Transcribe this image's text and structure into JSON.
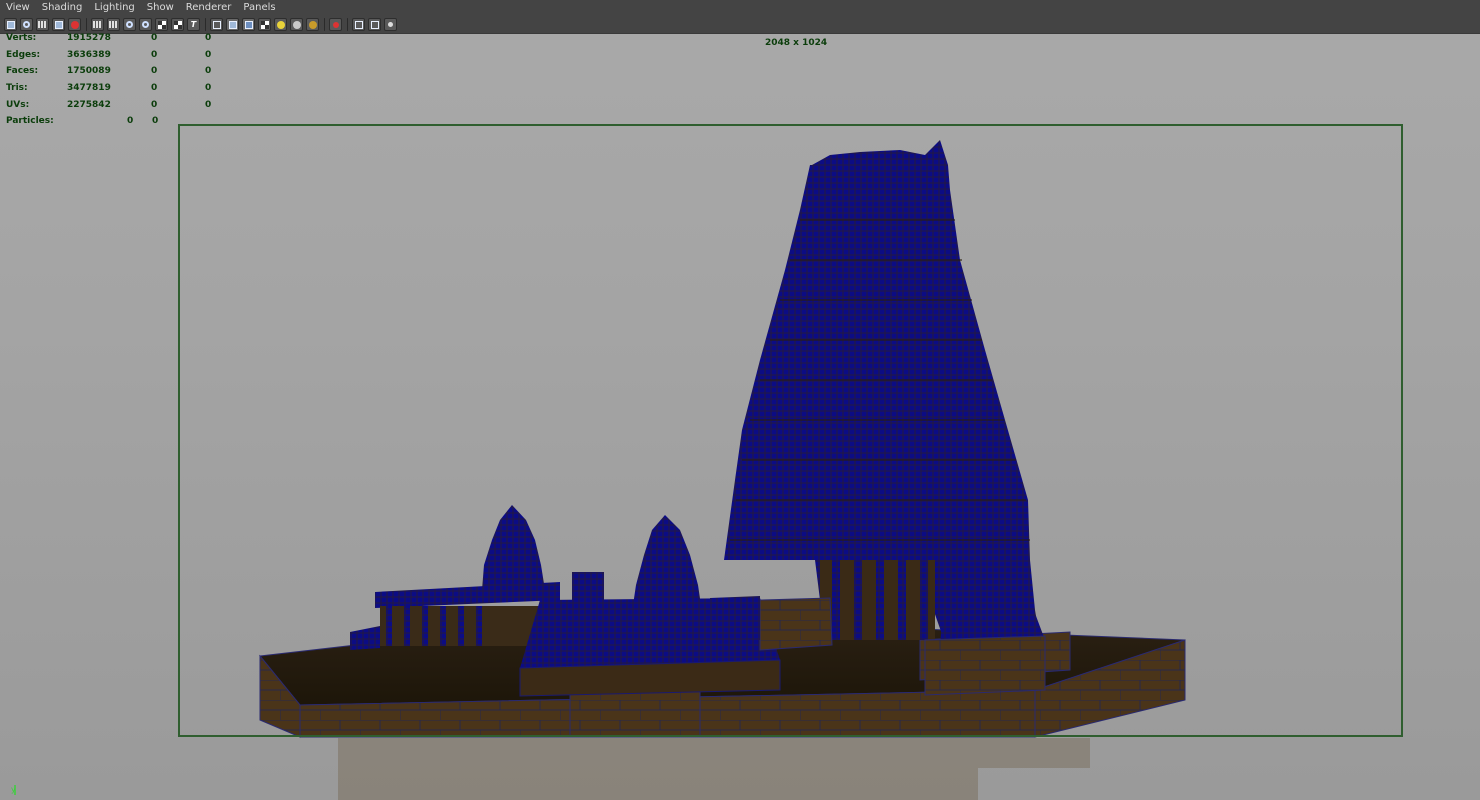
{
  "menu": {
    "items": [
      "View",
      "Shading",
      "Lighting",
      "Show",
      "Renderer",
      "Panels"
    ]
  },
  "toolbar": {
    "icons": [
      "select-camera-icon",
      "camera-attributes-icon",
      "bookmarks-icon",
      "image-plane-icon",
      "2d-pan-zoom-icon",
      "grid-icon",
      "film-gate-icon",
      "resolution-gate-icon",
      "gate-mask-icon",
      "field-chart-icon",
      "safe-action-icon",
      "wireframe-icon",
      "smooth-shade-icon",
      "wireframe-on-shaded-icon",
      "textured-icon",
      "default-light-icon",
      "all-lights-icon",
      "shadows-icon",
      "xray-icon",
      "isolate-select-icon",
      "backface-icon",
      "share-icon"
    ]
  },
  "hud": {
    "rows": [
      {
        "label": "Verts:",
        "values": [
          "1915278",
          "0",
          "0"
        ]
      },
      {
        "label": "Edges:",
        "values": [
          "3636389",
          "0",
          "0"
        ]
      },
      {
        "label": "Faces:",
        "values": [
          "1750089",
          "0",
          "0"
        ]
      },
      {
        "label": "Tris:",
        "values": [
          "3477819",
          "0",
          "0"
        ]
      },
      {
        "label": "UVs:",
        "values": [
          "2275842",
          "0",
          "0"
        ]
      }
    ],
    "particles": {
      "label": "Particles:",
      "values": [
        "0",
        "0"
      ]
    }
  },
  "resolution": "2048 x 1024",
  "axis": {
    "label": "y"
  },
  "colors": {
    "menubar": "#444444",
    "viewport_bg": "#a4a4a4",
    "hud_text": "#0b3d0b",
    "gate_border": "#2f5e2f",
    "wireframe": "#0a0a8a",
    "stone": "#3a2a16"
  }
}
